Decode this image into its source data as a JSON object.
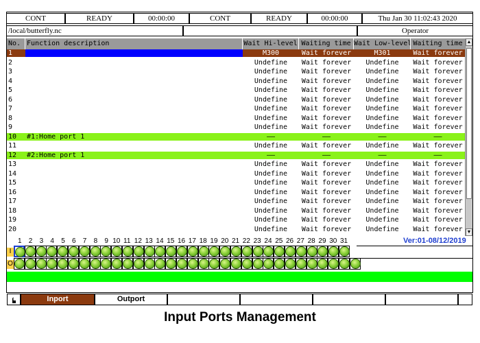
{
  "status_bar": [
    "CONT",
    "READY",
    "00:00:00",
    "CONT",
    "READY",
    "00:00:00",
    "Thu Jan 30 11:02:43 2020"
  ],
  "file_path": "/local/butterfly.nc",
  "user_role": "Operator",
  "table": {
    "headers": [
      "No.",
      "Function description",
      "Wait Hi-level",
      "Waiting time",
      "Wait Low-level",
      "Waiting time"
    ],
    "rows": [
      {
        "no": "1",
        "desc": "",
        "hi": "M300",
        "wt1": "Wait forever",
        "lo": "M301",
        "wt2": "Wait forever",
        "style": "selected"
      },
      {
        "no": "2",
        "desc": "",
        "hi": "Undefine",
        "wt1": "Wait forever",
        "lo": "Undefine",
        "wt2": "Wait forever"
      },
      {
        "no": "3",
        "desc": "",
        "hi": "Undefine",
        "wt1": "Wait forever",
        "lo": "Undefine",
        "wt2": "Wait forever"
      },
      {
        "no": "4",
        "desc": "",
        "hi": "Undefine",
        "wt1": "Wait forever",
        "lo": "Undefine",
        "wt2": "Wait forever"
      },
      {
        "no": "5",
        "desc": "",
        "hi": "Undefine",
        "wt1": "Wait forever",
        "lo": "Undefine",
        "wt2": "Wait forever"
      },
      {
        "no": "6",
        "desc": "",
        "hi": "Undefine",
        "wt1": "Wait forever",
        "lo": "Undefine",
        "wt2": "Wait forever"
      },
      {
        "no": "7",
        "desc": "",
        "hi": "Undefine",
        "wt1": "Wait forever",
        "lo": "Undefine",
        "wt2": "Wait forever"
      },
      {
        "no": "8",
        "desc": "",
        "hi": "Undefine",
        "wt1": "Wait forever",
        "lo": "Undefine",
        "wt2": "Wait forever"
      },
      {
        "no": "9",
        "desc": "",
        "hi": "Undefine",
        "wt1": "Wait forever",
        "lo": "Undefine",
        "wt2": "Wait forever"
      },
      {
        "no": "10",
        "desc": "#1:Home port 1",
        "hi": "——",
        "wt1": "——",
        "lo": "——",
        "wt2": "——",
        "style": "green"
      },
      {
        "no": "11",
        "desc": "",
        "hi": "Undefine",
        "wt1": "Wait forever",
        "lo": "Undefine",
        "wt2": "Wait forever"
      },
      {
        "no": "12",
        "desc": "#2:Home port 1",
        "hi": "——",
        "wt1": "——",
        "lo": "——",
        "wt2": "——",
        "style": "green"
      },
      {
        "no": "13",
        "desc": "",
        "hi": "Undefine",
        "wt1": "Wait forever",
        "lo": "Undefine",
        "wt2": "Wait forever"
      },
      {
        "no": "14",
        "desc": "",
        "hi": "Undefine",
        "wt1": "Wait forever",
        "lo": "Undefine",
        "wt2": "Wait forever"
      },
      {
        "no": "15",
        "desc": "",
        "hi": "Undefine",
        "wt1": "Wait forever",
        "lo": "Undefine",
        "wt2": "Wait forever"
      },
      {
        "no": "16",
        "desc": "",
        "hi": "Undefine",
        "wt1": "Wait forever",
        "lo": "Undefine",
        "wt2": "Wait forever"
      },
      {
        "no": "17",
        "desc": "",
        "hi": "Undefine",
        "wt1": "Wait forever",
        "lo": "Undefine",
        "wt2": "Wait forever"
      },
      {
        "no": "18",
        "desc": "",
        "hi": "Undefine",
        "wt1": "Wait forever",
        "lo": "Undefine",
        "wt2": "Wait forever"
      },
      {
        "no": "19",
        "desc": "",
        "hi": "Undefine",
        "wt1": "Wait forever",
        "lo": "Undefine",
        "wt2": "Wait forever"
      },
      {
        "no": "20",
        "desc": "",
        "hi": "Undefine",
        "wt1": "Wait forever",
        "lo": "Undefine",
        "wt2": "Wait forever"
      }
    ]
  },
  "port_numbers": [
    "1",
    "2",
    "3",
    "4",
    "5",
    "6",
    "7",
    "8",
    "9",
    "10",
    "11",
    "12",
    "13",
    "14",
    "15",
    "16",
    "17",
    "18",
    "19",
    "20",
    "21",
    "22",
    "23",
    "24",
    "25",
    "26",
    "27",
    "28",
    "29",
    "30",
    "31"
  ],
  "port_row_labels": [
    "I",
    "O"
  ],
  "version": "Ver:01-08/12/2019",
  "function_keys": [
    "Inport",
    "Outport",
    "",
    "",
    "",
    "",
    ""
  ],
  "caption": "Input Ports Management",
  "colors": {
    "selected_row": "#8b3a0f",
    "selected_desc": "#0000ff",
    "green_row": "#8af21a",
    "header_bg": "#9a9a9a",
    "status_green": "#00ff00",
    "version_text": "#1f3fd0"
  }
}
